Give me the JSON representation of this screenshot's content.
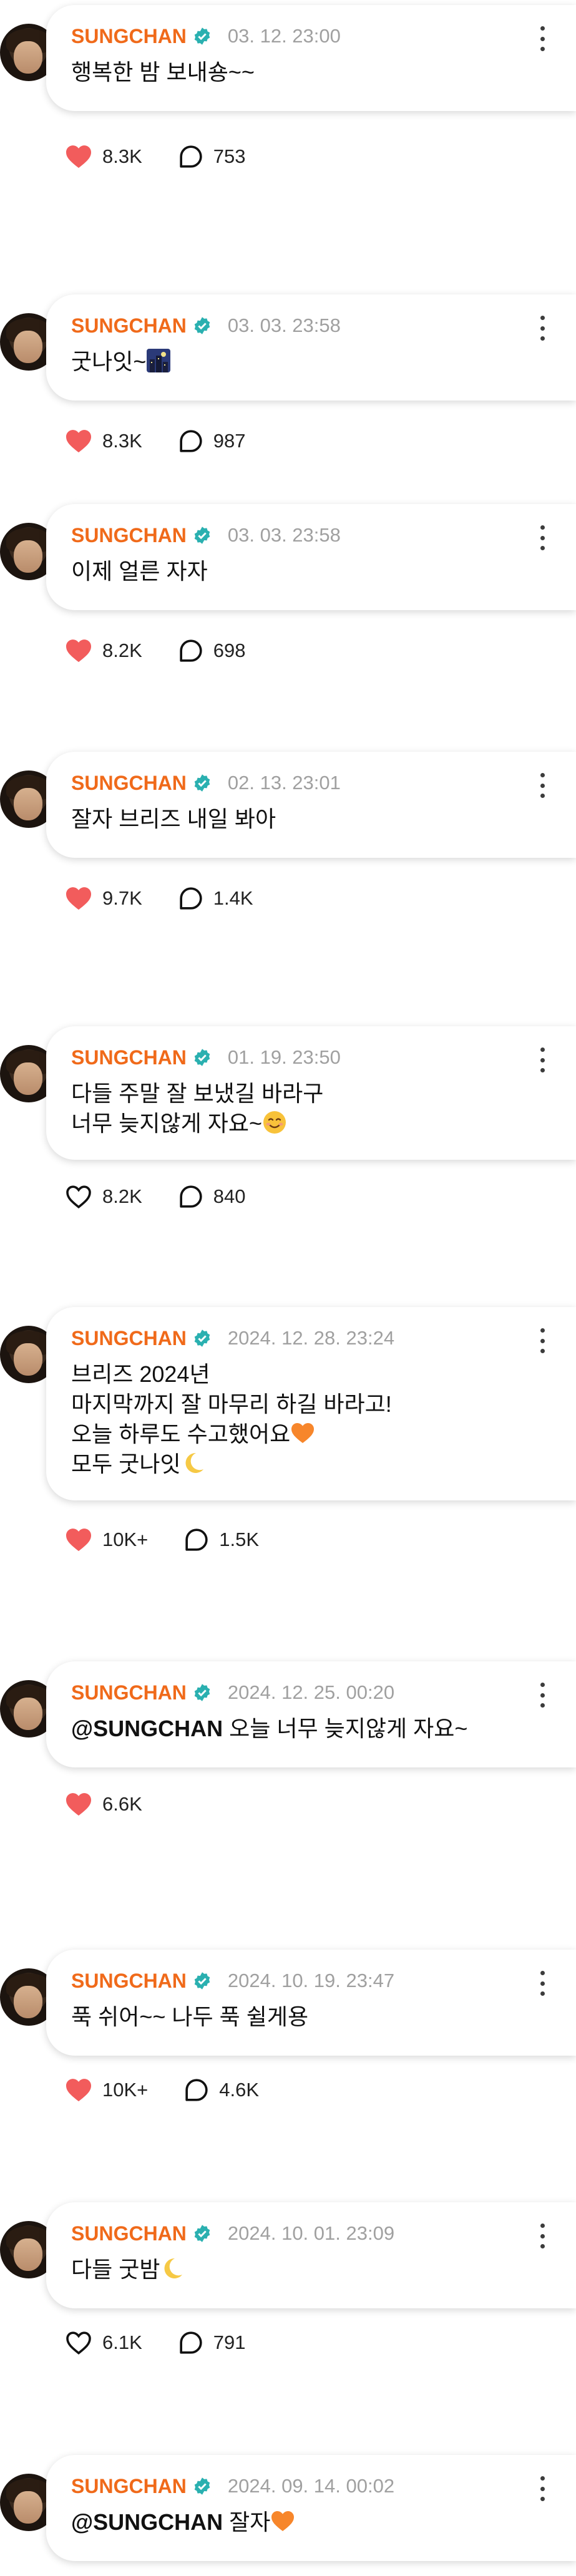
{
  "accent_color": "#f06a1a",
  "verified_color": "#2ab0b0",
  "posts": [
    {
      "author": "SUNGCHAN",
      "date": "03. 12. 23:00",
      "lines": [
        "행복한 밤 보내숑~~"
      ],
      "emoji": "",
      "mention": "",
      "likes": "8.3K",
      "comments": "753",
      "liked": true
    },
    {
      "author": "SUNGCHAN",
      "date": "03. 03. 23:58",
      "lines": [
        "굿나잇~"
      ],
      "emoji": "night-cityscape",
      "mention": "",
      "likes": "8.3K",
      "comments": "987",
      "liked": true
    },
    {
      "author": "SUNGCHAN",
      "date": "03. 03. 23:58",
      "lines": [
        "이제 얼른 자자"
      ],
      "emoji": "",
      "mention": "",
      "likes": "8.2K",
      "comments": "698",
      "liked": true
    },
    {
      "author": "SUNGCHAN",
      "date": "02. 13. 23:01",
      "lines": [
        "잘자 브리즈 내일 봐아"
      ],
      "emoji": "",
      "mention": "",
      "likes": "9.7K",
      "comments": "1.4K",
      "liked": true
    },
    {
      "author": "SUNGCHAN",
      "date": "01. 19. 23:50",
      "lines": [
        "다들 주말 잘 보냈길 바라구",
        "너무 늦지않게 자요~"
      ],
      "emoji": "smiling-face",
      "mention": "",
      "likes": "8.2K",
      "comments": "840",
      "liked": false
    },
    {
      "author": "SUNGCHAN",
      "date": "2024. 12. 28. 23:24",
      "lines": [
        "브리즈 2024년",
        "마지막까지 잘 마무리 하길 바라고!",
        "오늘 하루도 수고했어요",
        "모두 굿나잇"
      ],
      "emoji": "",
      "mention": "",
      "likes": "10K+",
      "comments": "1.5K",
      "liked": true
    },
    {
      "author": "SUNGCHAN",
      "date": "2024. 12. 25. 00:20",
      "lines": [
        "오늘 너무 늦지않게 자요~"
      ],
      "emoji": "",
      "mention": "@SUNGCHAN",
      "likes": "6.6K",
      "comments": "",
      "liked": true
    },
    {
      "author": "SUNGCHAN",
      "date": "2024. 10. 19. 23:47",
      "lines": [
        "푹 쉬어~~ 나두 푹 쉴게용"
      ],
      "emoji": "",
      "mention": "",
      "likes": "10K+",
      "comments": "4.6K",
      "liked": true
    },
    {
      "author": "SUNGCHAN",
      "date": "2024. 10. 01. 23:09",
      "lines": [
        "다들 굿밤"
      ],
      "emoji": "crescent-moon",
      "mention": "",
      "likes": "6.1K",
      "comments": "791",
      "liked": false
    },
    {
      "author": "SUNGCHAN",
      "date": "2024. 09. 14. 00:02",
      "lines": [
        "잘자"
      ],
      "emoji": "orange-heart",
      "mention": "@SUNGCHAN",
      "likes": "",
      "comments": "",
      "liked": false
    }
  ]
}
